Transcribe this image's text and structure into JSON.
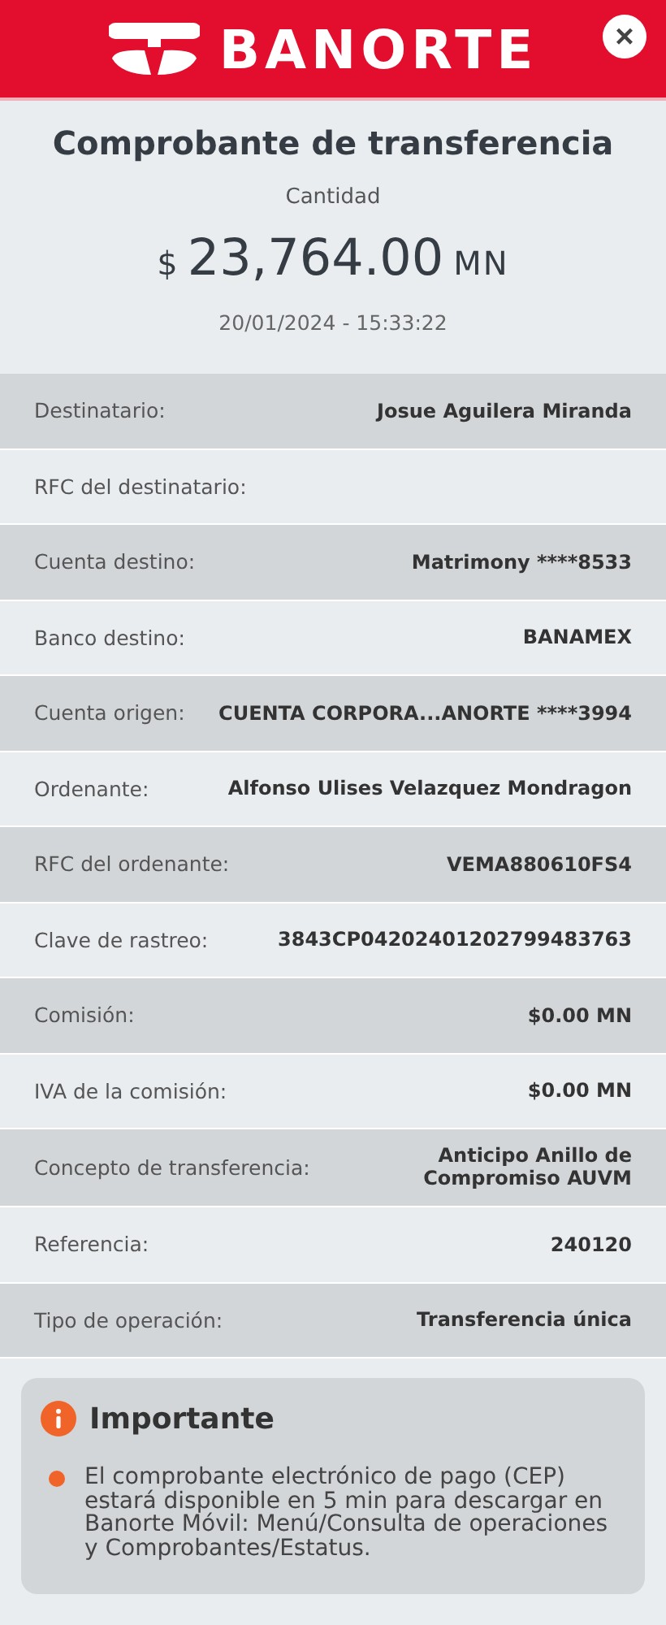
{
  "header": {
    "brand": "BANORTE",
    "close": "×"
  },
  "title": "Comprobante de transferencia",
  "amount_label": "Cantidad",
  "amount": {
    "currency_symbol": "$",
    "value": "23,764.00",
    "currency": "MN"
  },
  "datetime": "20/01/2024 - 15:33:22",
  "details": [
    {
      "label": "Destinatario:",
      "value": "Josue Aguilera Miranda"
    },
    {
      "label": "RFC del destinatario:"
    },
    {
      "label": "Cuenta destino:",
      "value": "Matrimony ****8533"
    },
    {
      "label": "Banco destino:",
      "value": "BANAMEX"
    },
    {
      "label": "Cuenta origen:",
      "value": "CUENTA CORPORA...ANORTE ****3994"
    },
    {
      "label": "Ordenante:",
      "value": "Alfonso Ulises Velazquez Mondragon"
    },
    {
      "label": "RFC del ordenante:",
      "value": "VEMA880610FS4"
    },
    {
      "label": "Clave de rastreo:",
      "value": "3843CP04202401202799483763"
    },
    {
      "label": "Comisión:",
      "value": "$0.00 MN"
    },
    {
      "label": "IVA de la comisión:",
      "value": "$0.00 MN"
    },
    {
      "label": "Concepto de transferencia:",
      "value": "Anticipo Anillo de Compromiso AUVM"
    },
    {
      "label": "Referencia:",
      "value": "240120"
    },
    {
      "label": "Tipo de operación:",
      "value": "Transferencia única"
    }
  ],
  "notice": {
    "title": "Importante",
    "items": [
      "El comprobante electrónico de pago (CEP) estará disponible en 5 min para descargar en Banorte Móvil: Menú/Consulta de operaciones y Comprobantes/Estatus."
    ]
  }
}
